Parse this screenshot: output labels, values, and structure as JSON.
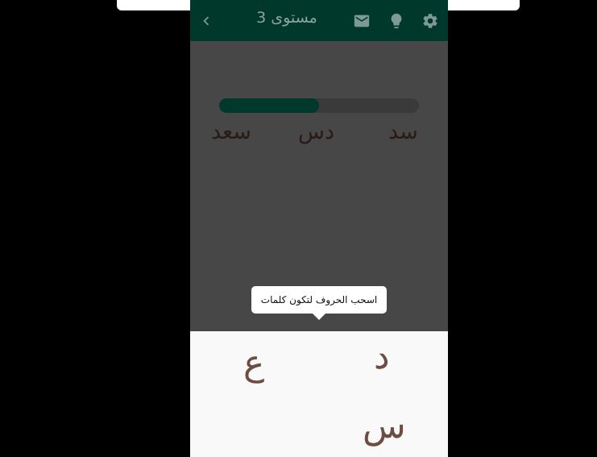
{
  "header": {
    "title": "مستوى 3",
    "icons": {
      "back": "chevron-left-icon",
      "mail": "mail-icon",
      "hint": "lightbulb-icon",
      "settings": "gear-icon"
    }
  },
  "progress": {
    "value_fraction": 0.5
  },
  "words": [
    "سد",
    "دس",
    "سعد"
  ],
  "tooltip": {
    "text": "اسحب الحروف لتكون كلمات"
  },
  "letters": [
    "د",
    "ع",
    "س"
  ],
  "colors": {
    "accent": "#00382c",
    "letters": "#6d4c41"
  }
}
